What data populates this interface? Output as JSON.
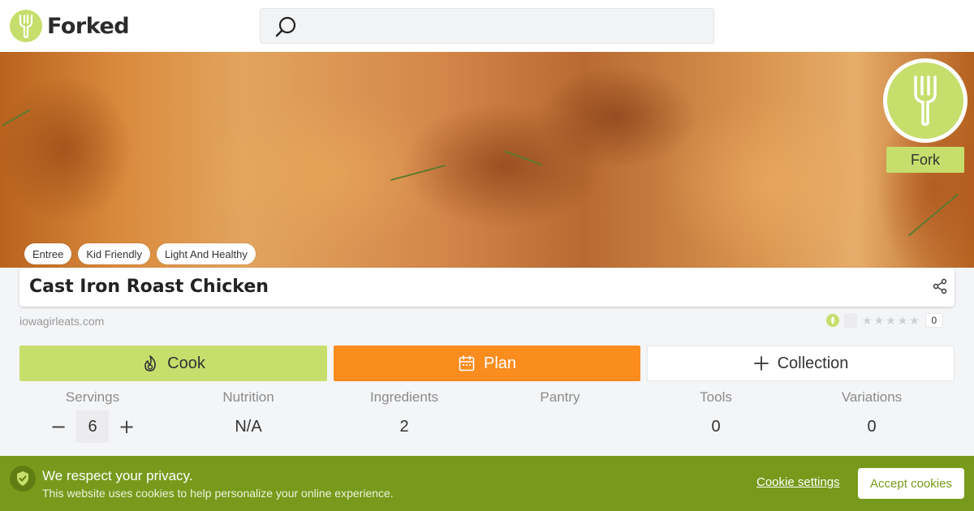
{
  "brand": {
    "name": "Forked",
    "accent": "#c6de6c"
  },
  "search": {
    "placeholder": ""
  },
  "hero": {
    "fork_label": "Fork"
  },
  "tags": [
    "Entree",
    "Kid Friendly",
    "Light And Healthy"
  ],
  "recipe": {
    "title": "Cast Iron Roast Chicken",
    "source": "iowagirleats.com"
  },
  "rating": {
    "stars": 0,
    "max_stars": 5,
    "count": "0"
  },
  "actions": {
    "cook": "Cook",
    "plan": "Plan",
    "collection": "Collection"
  },
  "stats": {
    "servings": {
      "label": "Servings",
      "value": "6",
      "minus": "−",
      "plus": "+"
    },
    "nutrition": {
      "label": "Nutrition",
      "value": "N/A"
    },
    "ingredients": {
      "label": "Ingredients",
      "value": "2"
    },
    "pantry": {
      "label": "Pantry",
      "value": ""
    },
    "tools": {
      "label": "Tools",
      "value": "0"
    },
    "variations": {
      "label": "Variations",
      "value": "0"
    }
  },
  "cookie": {
    "title": "We respect your privacy.",
    "text": "This website uses cookies to help personalize your online experience.",
    "settings": "Cookie settings",
    "accept": "Accept cookies"
  },
  "colors": {
    "cook": "#c6de6c",
    "plan": "#fb8c1e",
    "cookie_bar": "#779a1c"
  }
}
